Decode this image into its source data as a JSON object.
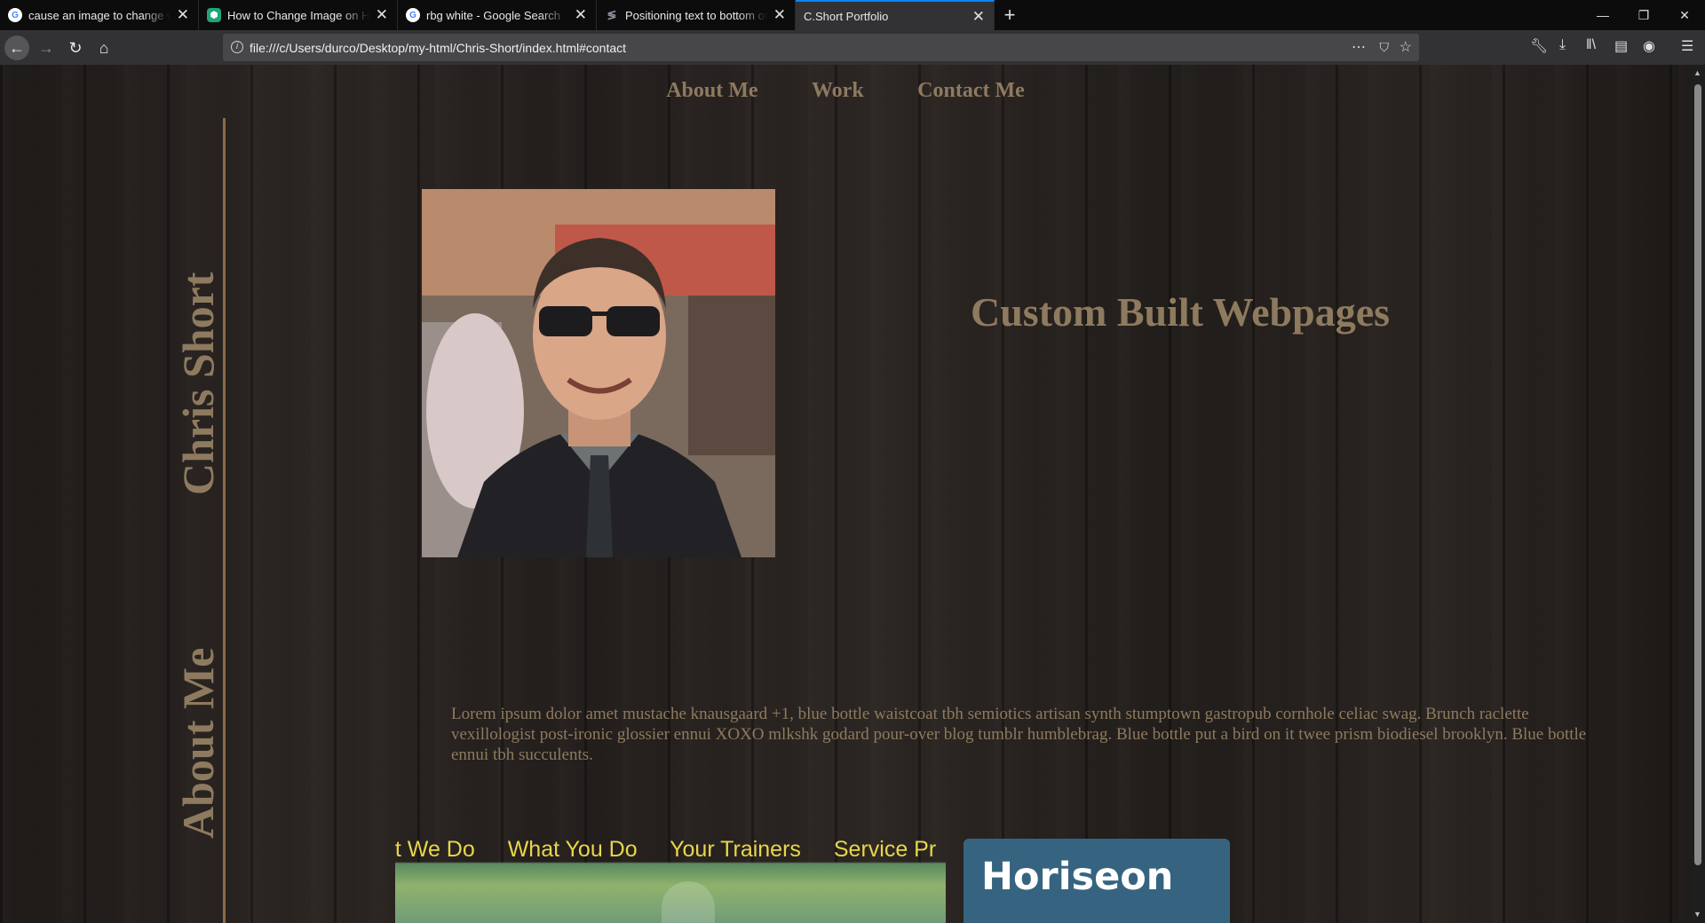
{
  "browser": {
    "tabs": [
      {
        "title": "cause an image to change whe",
        "favicon": "google-icon",
        "active": false
      },
      {
        "title": "How to Change Image on Hov",
        "favicon": "wikihow-icon",
        "active": false
      },
      {
        "title": "rbg white - Google Search",
        "favicon": "google-icon",
        "active": false
      },
      {
        "title": "Positioning text to bottom of d",
        "favicon": "stackoverflow-icon",
        "active": false
      },
      {
        "title": "C.Short Portfolio",
        "favicon": "",
        "active": true
      }
    ],
    "url": "file:///c/Users/durco/Desktop/my-html/Chris-Short/index.html#contact",
    "accent_color": "#0a84ff"
  },
  "site": {
    "nav": [
      "About Me",
      "Work",
      "Contact Me"
    ],
    "side_name": "Chris Short",
    "side_section": "About Me",
    "tagline": "Custom Built Webpages",
    "bio": "Lorem ipsum dolor amet mustache knausgaard +1, blue bottle waistcoat tbh semiotics artisan synth stumptown gastropub cornhole celiac swag. Brunch raclette vexillologist post-ironic glossier ennui XOXO mlkshk godard pour-over blog tumblr humblebrag. Blue bottle put a bird on it twee prism biodiesel brooklyn. Blue bottle ennui tbh succulents.",
    "text_color": "#8e7a5e",
    "work_cards": [
      {
        "nav_items": [
          "at We Do",
          "What You Do",
          "Your Trainers",
          "Service Pr"
        ]
      },
      {
        "brand": "Horiseon",
        "color": "#366480"
      }
    ]
  }
}
